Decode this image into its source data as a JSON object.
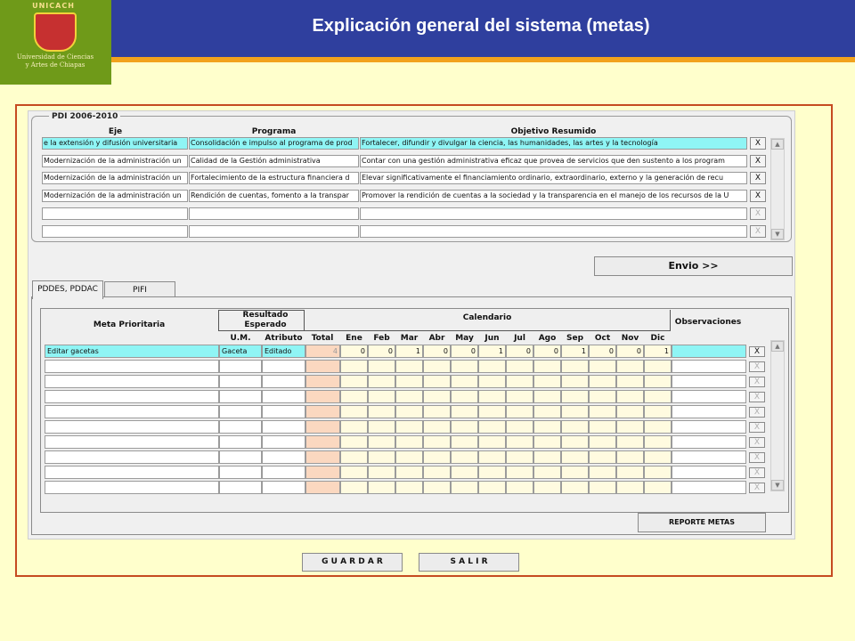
{
  "header": {
    "title": "Explicación general del sistema (metas)",
    "logo_arc": "UNICACH",
    "logo_text_line1": "Universidad de Ciencias",
    "logo_text_line2": "y Artes de Chiapas"
  },
  "pdi": {
    "group_title": "PDI 2006-2010",
    "headers": {
      "eje": "Eje",
      "programa": "Programa",
      "objetivo": "Objetivo Resumido"
    },
    "rows": [
      {
        "eje": "e la extensión y difusión universitaria",
        "programa": "Consolidación e impulso al programa de prod",
        "objetivo": "Fortalecer, difundir y divulgar la ciencia, las humanidades, las artes y la tecnología"
      },
      {
        "eje": "Modernización de la administración un",
        "programa": "Calidad de la Gestión administrativa",
        "objetivo": "Contar con una gestión administrativa eficaz que provea de servicios que den sustento a los program"
      },
      {
        "eje": "Modernización de la administración un",
        "programa": "Fortalecimiento de la estructura financiera d",
        "objetivo": "Elevar significativamente el financiamiento ordinario, extraordinario, externo y la generación de recu"
      },
      {
        "eje": "Modernización de la administración un",
        "programa": "Rendición de cuentas, fomento a la transpar",
        "objetivo": "Promover la rendición de cuentas a la sociedad y la transparencia en el manejo de los recursos de la U"
      },
      {
        "eje": "",
        "programa": "",
        "objetivo": ""
      },
      {
        "eje": "",
        "programa": "",
        "objetivo": ""
      }
    ],
    "x_label": "X",
    "envio_label": "Envio >>"
  },
  "tabs": [
    {
      "label": "PDDES, PDDAC"
    },
    {
      "label": "PIFI"
    }
  ],
  "metas": {
    "headers": {
      "meta": "Meta Prioritaria",
      "resultado": "Resultado Esperado",
      "calendario": "Calendario",
      "observaciones": "Observaciones",
      "um": "U.M.",
      "atributo": "Atributo",
      "total": "Total",
      "months": [
        "Ene",
        "Feb",
        "Mar",
        "Abr",
        "May",
        "Jun",
        "Jul",
        "Ago",
        "Sep",
        "Oct",
        "Nov",
        "Dic"
      ]
    },
    "rows": [
      {
        "meta": "Editar gacetas",
        "um": "Gaceta",
        "atributo": "Editado",
        "total": "4",
        "months": [
          "0",
          "0",
          "1",
          "0",
          "0",
          "1",
          "0",
          "0",
          "1",
          "0",
          "0",
          "1"
        ],
        "obs": ""
      },
      {
        "meta": "",
        "um": "",
        "atributo": "",
        "total": "",
        "months": [
          "",
          "",
          "",
          "",
          "",
          "",
          "",
          "",
          "",
          "",
          "",
          ""
        ],
        "obs": ""
      },
      {
        "meta": "",
        "um": "",
        "atributo": "",
        "total": "",
        "months": [
          "",
          "",
          "",
          "",
          "",
          "",
          "",
          "",
          "",
          "",
          "",
          ""
        ],
        "obs": ""
      },
      {
        "meta": "",
        "um": "",
        "atributo": "",
        "total": "",
        "months": [
          "",
          "",
          "",
          "",
          "",
          "",
          "",
          "",
          "",
          "",
          "",
          ""
        ],
        "obs": ""
      },
      {
        "meta": "",
        "um": "",
        "atributo": "",
        "total": "",
        "months": [
          "",
          "",
          "",
          "",
          "",
          "",
          "",
          "",
          "",
          "",
          "",
          ""
        ],
        "obs": ""
      },
      {
        "meta": "",
        "um": "",
        "atributo": "",
        "total": "",
        "months": [
          "",
          "",
          "",
          "",
          "",
          "",
          "",
          "",
          "",
          "",
          "",
          ""
        ],
        "obs": ""
      },
      {
        "meta": "",
        "um": "",
        "atributo": "",
        "total": "",
        "months": [
          "",
          "",
          "",
          "",
          "",
          "",
          "",
          "",
          "",
          "",
          "",
          ""
        ],
        "obs": ""
      },
      {
        "meta": "",
        "um": "",
        "atributo": "",
        "total": "",
        "months": [
          "",
          "",
          "",
          "",
          "",
          "",
          "",
          "",
          "",
          "",
          "",
          ""
        ],
        "obs": ""
      },
      {
        "meta": "",
        "um": "",
        "atributo": "",
        "total": "",
        "months": [
          "",
          "",
          "",
          "",
          "",
          "",
          "",
          "",
          "",
          "",
          "",
          ""
        ],
        "obs": ""
      },
      {
        "meta": "",
        "um": "",
        "atributo": "",
        "total": "",
        "months": [
          "",
          "",
          "",
          "",
          "",
          "",
          "",
          "",
          "",
          "",
          "",
          ""
        ],
        "obs": ""
      }
    ],
    "x_label": "X",
    "reporte_label": "REPORTE METAS"
  },
  "footer": {
    "guardar_label": "G U A R D A R",
    "salir_label": "S A L I R"
  },
  "colors": {
    "header_bg": "#2f3f9e",
    "logo_bg": "#6f9a19",
    "accent_strip": "#f2a21c",
    "frame_border": "#c64b21",
    "page_bg": "#ffffcc",
    "selected_row": "#8ff5f5"
  }
}
